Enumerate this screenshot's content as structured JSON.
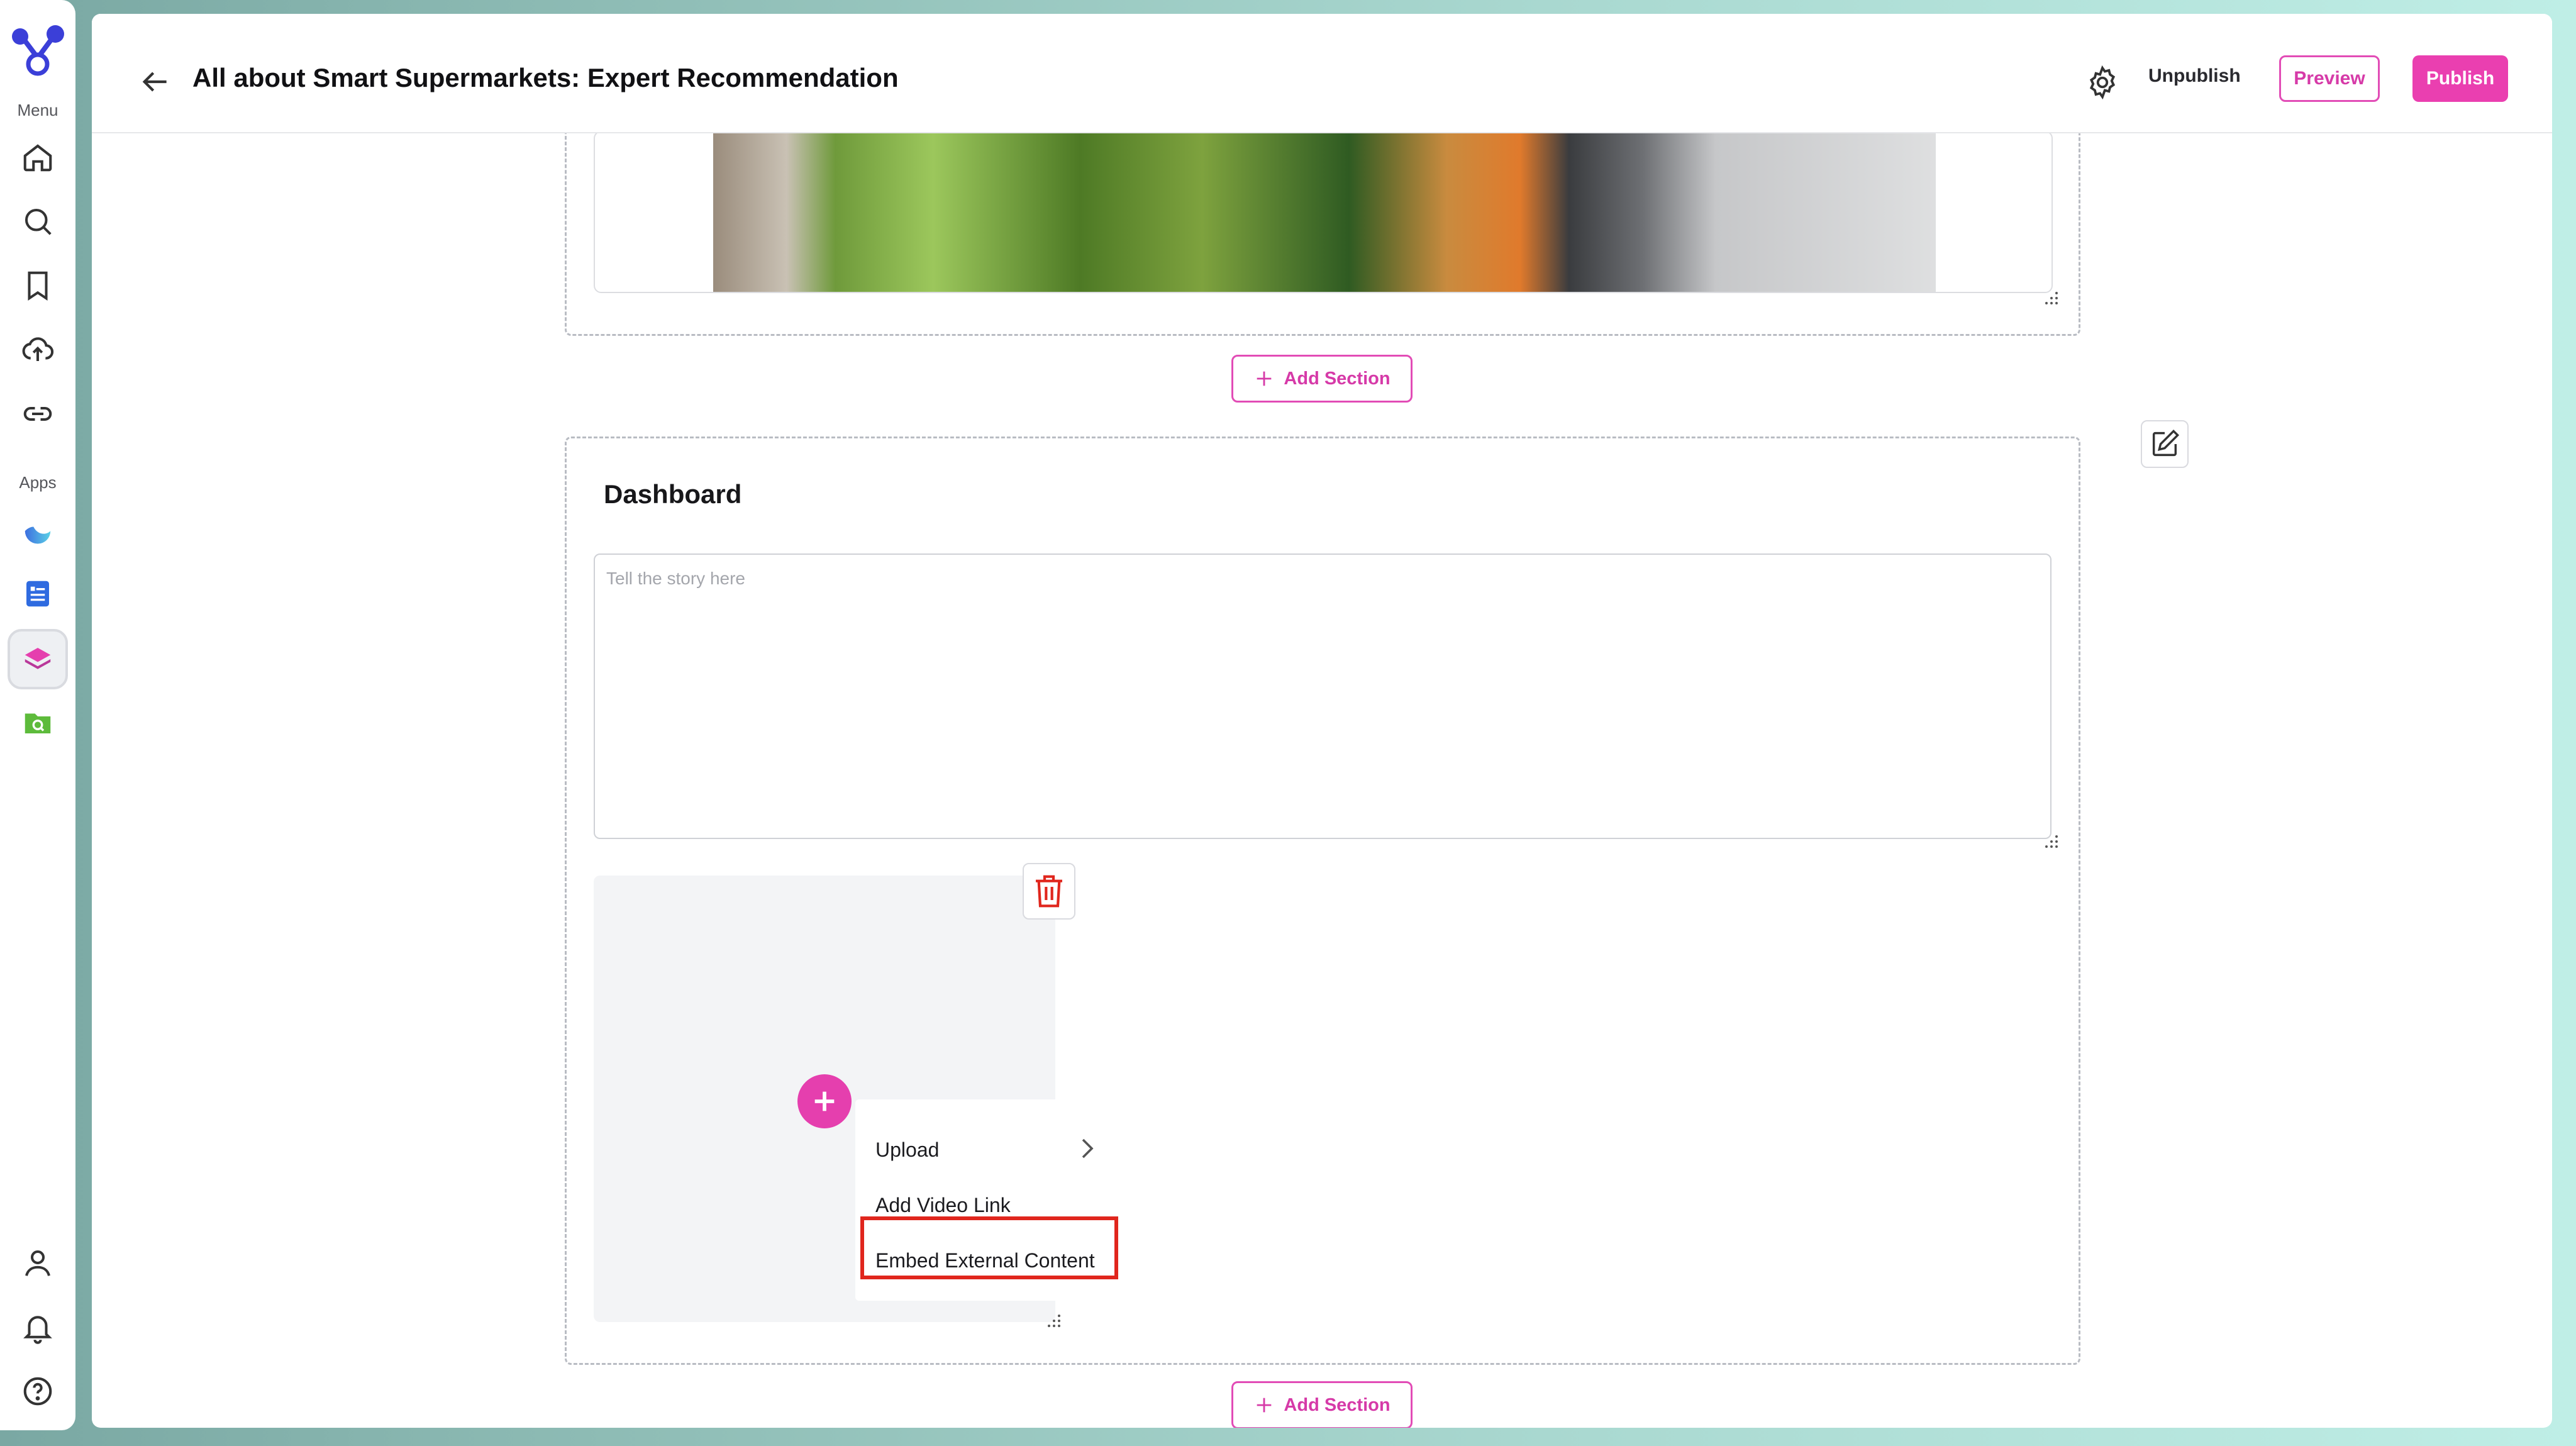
{
  "rail": {
    "menu_label": "Menu",
    "apps_label": "Apps",
    "menu_icons": [
      "home-icon",
      "search-icon",
      "bookmark-icon",
      "cloud-upload-icon",
      "link-icon"
    ],
    "app_icons": [
      "moon-app-icon",
      "notes-app-icon",
      "stack-app-icon",
      "folder-search-app-icon"
    ],
    "bottom_icons": [
      "user-icon",
      "bell-icon",
      "help-icon"
    ]
  },
  "header": {
    "title": "All about Smart Supermarkets: Expert Recommendation",
    "unpublish_label": "Unpublish",
    "preview_label": "Preview",
    "publish_label": "Publish"
  },
  "sections": {
    "add_section_label": "Add Section",
    "dashboard_title": "Dashboard",
    "story_placeholder": "Tell the story here"
  },
  "media_menu": {
    "items": [
      "Upload",
      "Add Video Link",
      "Embed External Content"
    ],
    "highlighted": "Embed External Content"
  },
  "colors": {
    "accent": "#ea3fb0",
    "highlight_border": "#e0261d",
    "trash": "#e0261d"
  }
}
